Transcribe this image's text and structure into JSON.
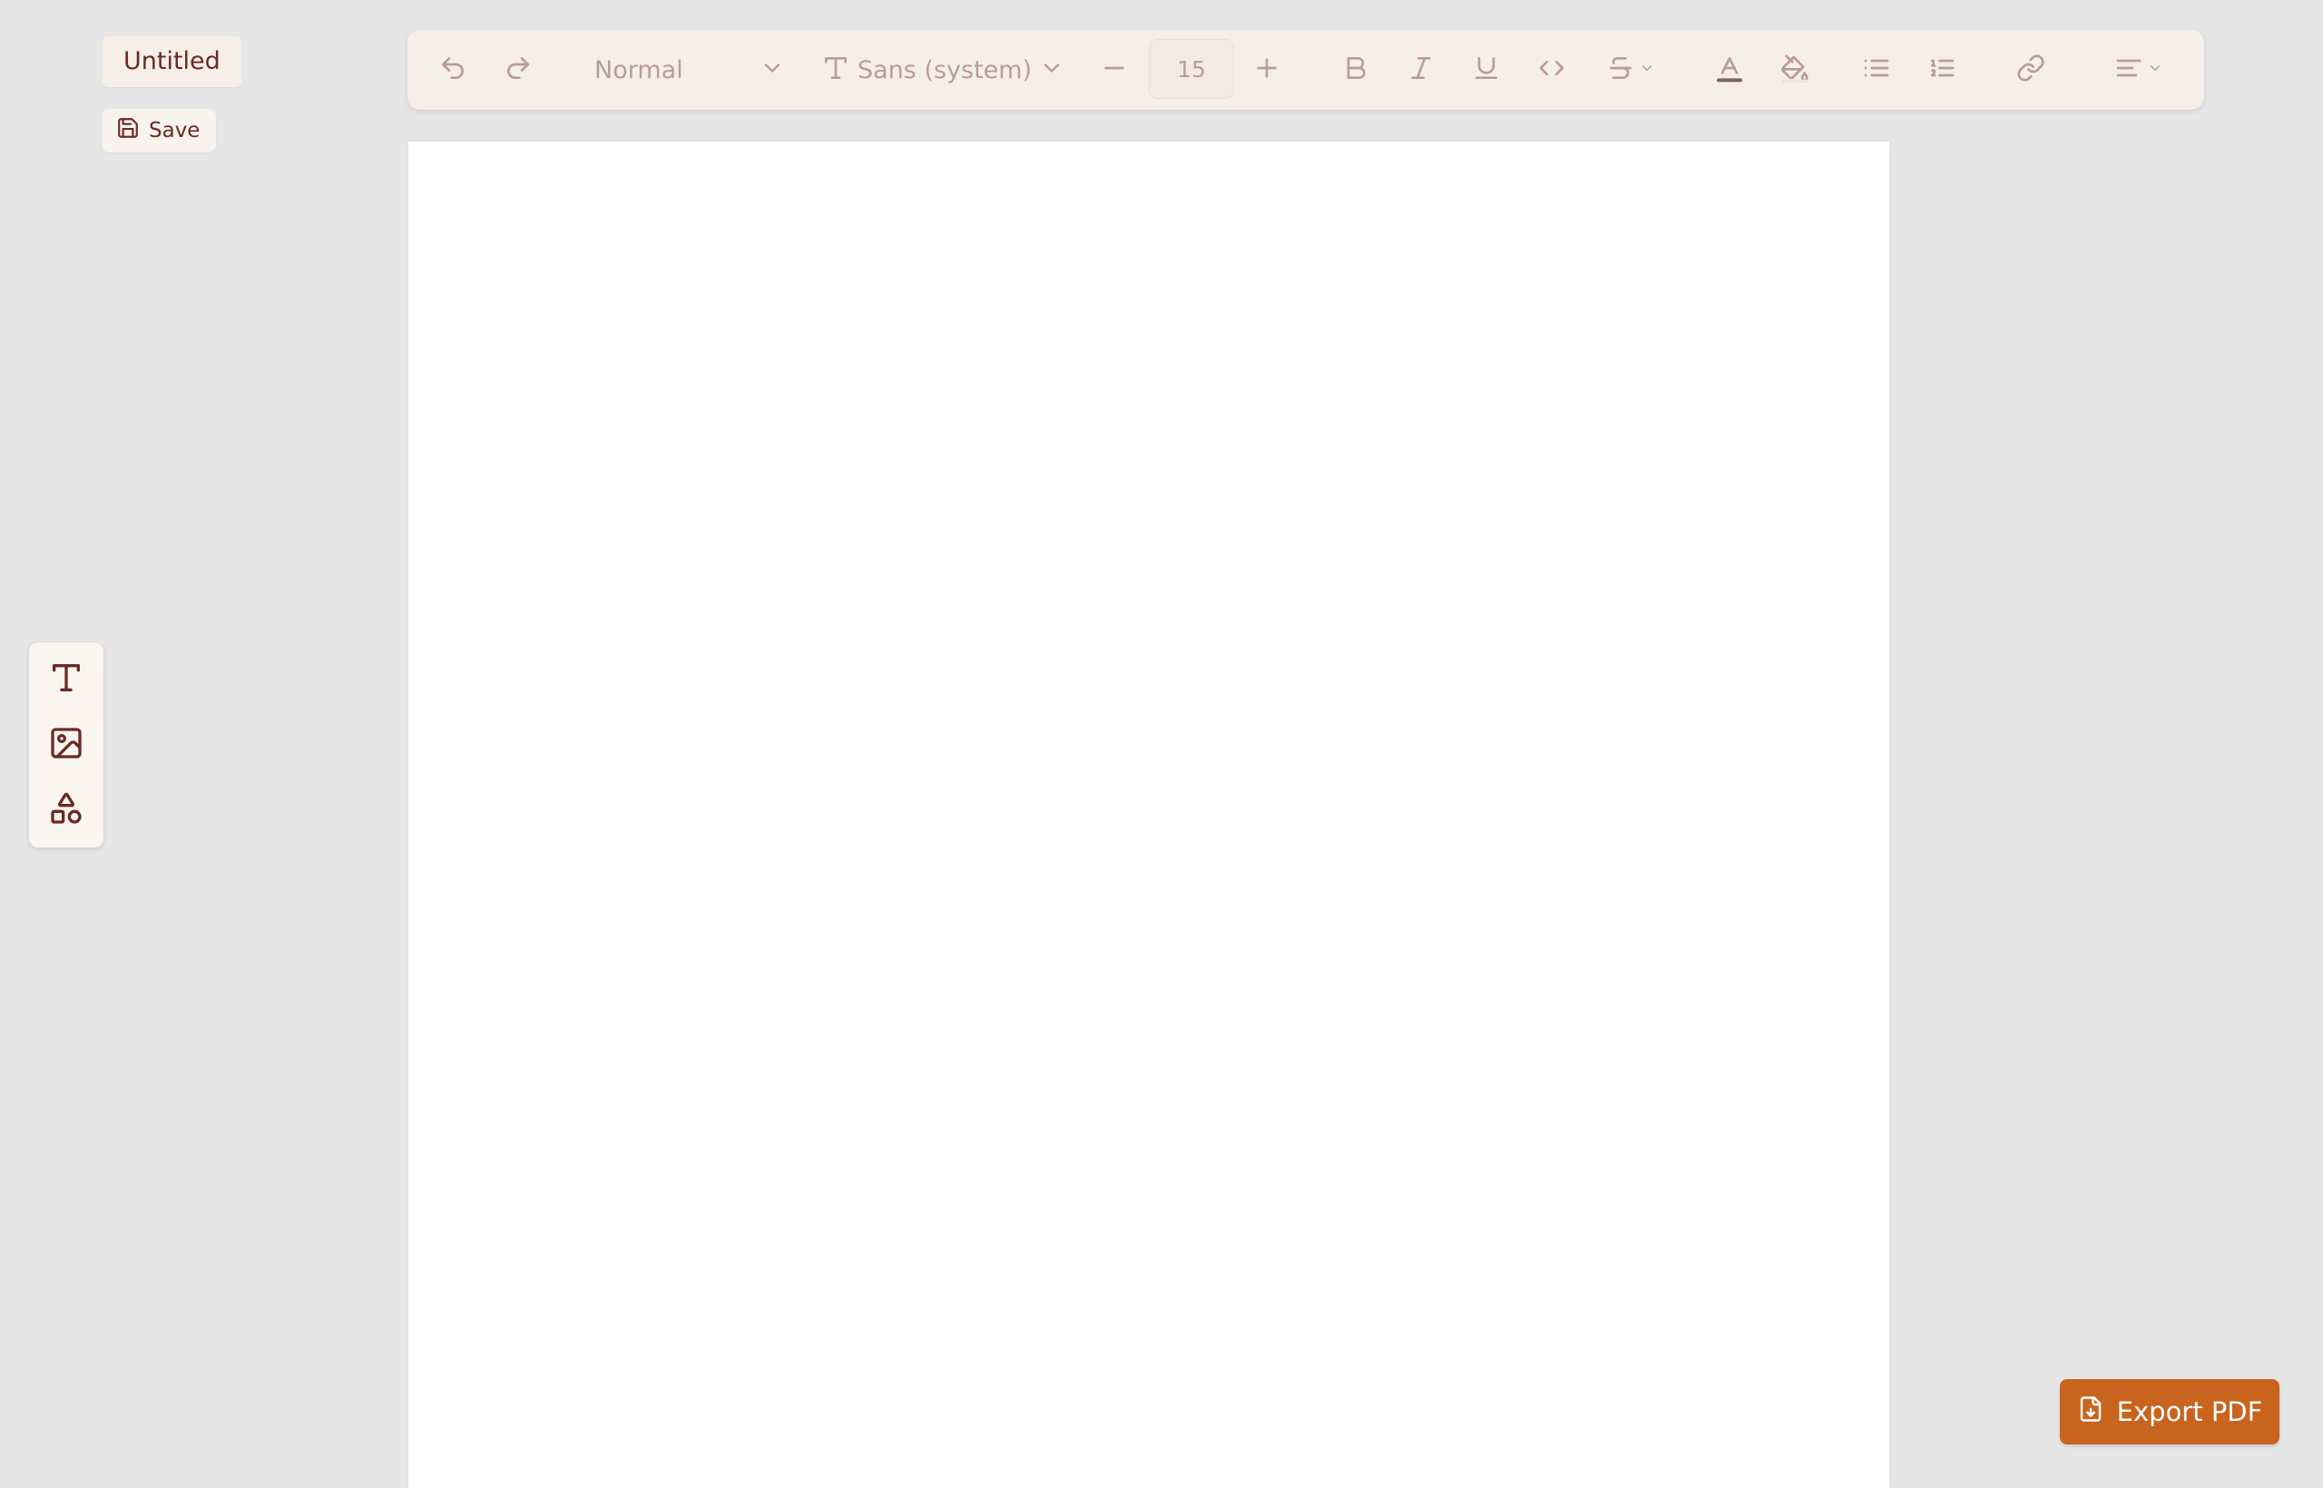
{
  "document": {
    "title": "Untitled",
    "save_label": "Save"
  },
  "toolbar": {
    "block_type": "Normal",
    "font_family": "Sans (system)",
    "font_size": "15",
    "icons": [
      "undo-icon",
      "redo-icon",
      "chevron-down-icon",
      "font-icon",
      "minus-icon",
      "plus-icon",
      "bold-icon",
      "italic-icon",
      "underline-icon",
      "code-icon",
      "strikethrough-icon",
      "text-color-icon",
      "highlight-icon",
      "bullet-list-icon",
      "numbered-list-icon",
      "link-icon",
      "align-icon"
    ]
  },
  "left_rail": {
    "tools": [
      {
        "name": "text-tool",
        "icon": "text-icon"
      },
      {
        "name": "image-tool",
        "icon": "image-icon"
      },
      {
        "name": "shapes-tool",
        "icon": "shapes-icon"
      }
    ]
  },
  "export": {
    "label": "Export PDF"
  },
  "colors": {
    "background": "#e6e6e6",
    "toolbar_bg": "#f6efe7",
    "toolbar_fg": "#b99d95",
    "brand_dark": "#6b2a26",
    "export_accent": "#c9641e"
  }
}
